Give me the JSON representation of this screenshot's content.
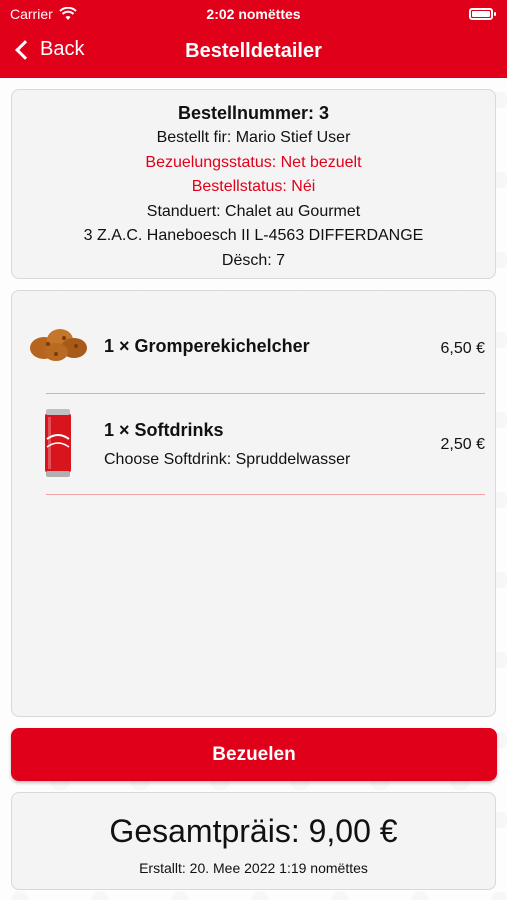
{
  "status_bar": {
    "carrier": "Carrier",
    "time": "2:02 nomëttes"
  },
  "nav": {
    "back_label": "Back",
    "title": "Bestelldetailer"
  },
  "order": {
    "number_line": "Bestellnummer: 3",
    "ordered_for": "Bestellt fir: Mario Stief User",
    "payment_status": "Bezuelungsstatus: Net bezuelt",
    "order_status": "Bestellstatus: Néi",
    "location": "Standuert: Chalet au Gourmet",
    "address": "3 Z.A.C. Haneboesch II L-4563 DIFFERDANGE",
    "table": "Dësch: 7"
  },
  "items": [
    {
      "name": "1 × Gromperekichelcher",
      "price": "6,50 €",
      "image": "potato-fritters-image"
    },
    {
      "name": "1 × Softdrinks",
      "option": "Choose Softdrink: Spruddelwasser",
      "price": "2,50 €",
      "image": "cola-can-image"
    }
  ],
  "pay_button_label": "Bezuelen",
  "total": {
    "label": "Gesamtpräis: 9,00 €",
    "created": "Erstallt: 20. Mee 2022 1:19 nomëttes"
  },
  "colors": {
    "primary": "#e1001a",
    "divider": "#f2a3a8",
    "card_bg": "#f4f4f4"
  }
}
